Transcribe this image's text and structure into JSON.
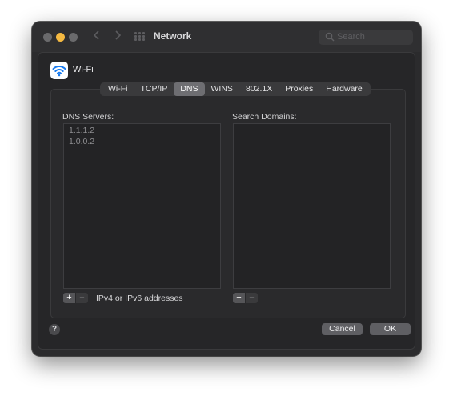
{
  "window": {
    "title": "Network",
    "search_placeholder": "Search"
  },
  "service": {
    "name": "Wi-Fi",
    "icon": "wifi-icon"
  },
  "tabs": [
    {
      "label": "Wi-Fi"
    },
    {
      "label": "TCP/IP"
    },
    {
      "label": "DNS",
      "active": true
    },
    {
      "label": "WINS"
    },
    {
      "label": "802.1X"
    },
    {
      "label": "Proxies"
    },
    {
      "label": "Hardware"
    }
  ],
  "dns": {
    "label": "DNS Servers:",
    "servers": [
      "1.1.1.2",
      "1.0.0.2"
    ],
    "hint": "IPv4 or IPv6 addresses"
  },
  "search_domains": {
    "label": "Search Domains:"
  },
  "controls": {
    "plus": "+",
    "minus": "−"
  },
  "footer": {
    "help": "?",
    "cancel": "Cancel",
    "ok": "OK"
  },
  "colors": {
    "window_bg": "#2b2b2d",
    "wifi_blue": "#1a7cf0",
    "minimize_yellow": "#f5b941"
  }
}
